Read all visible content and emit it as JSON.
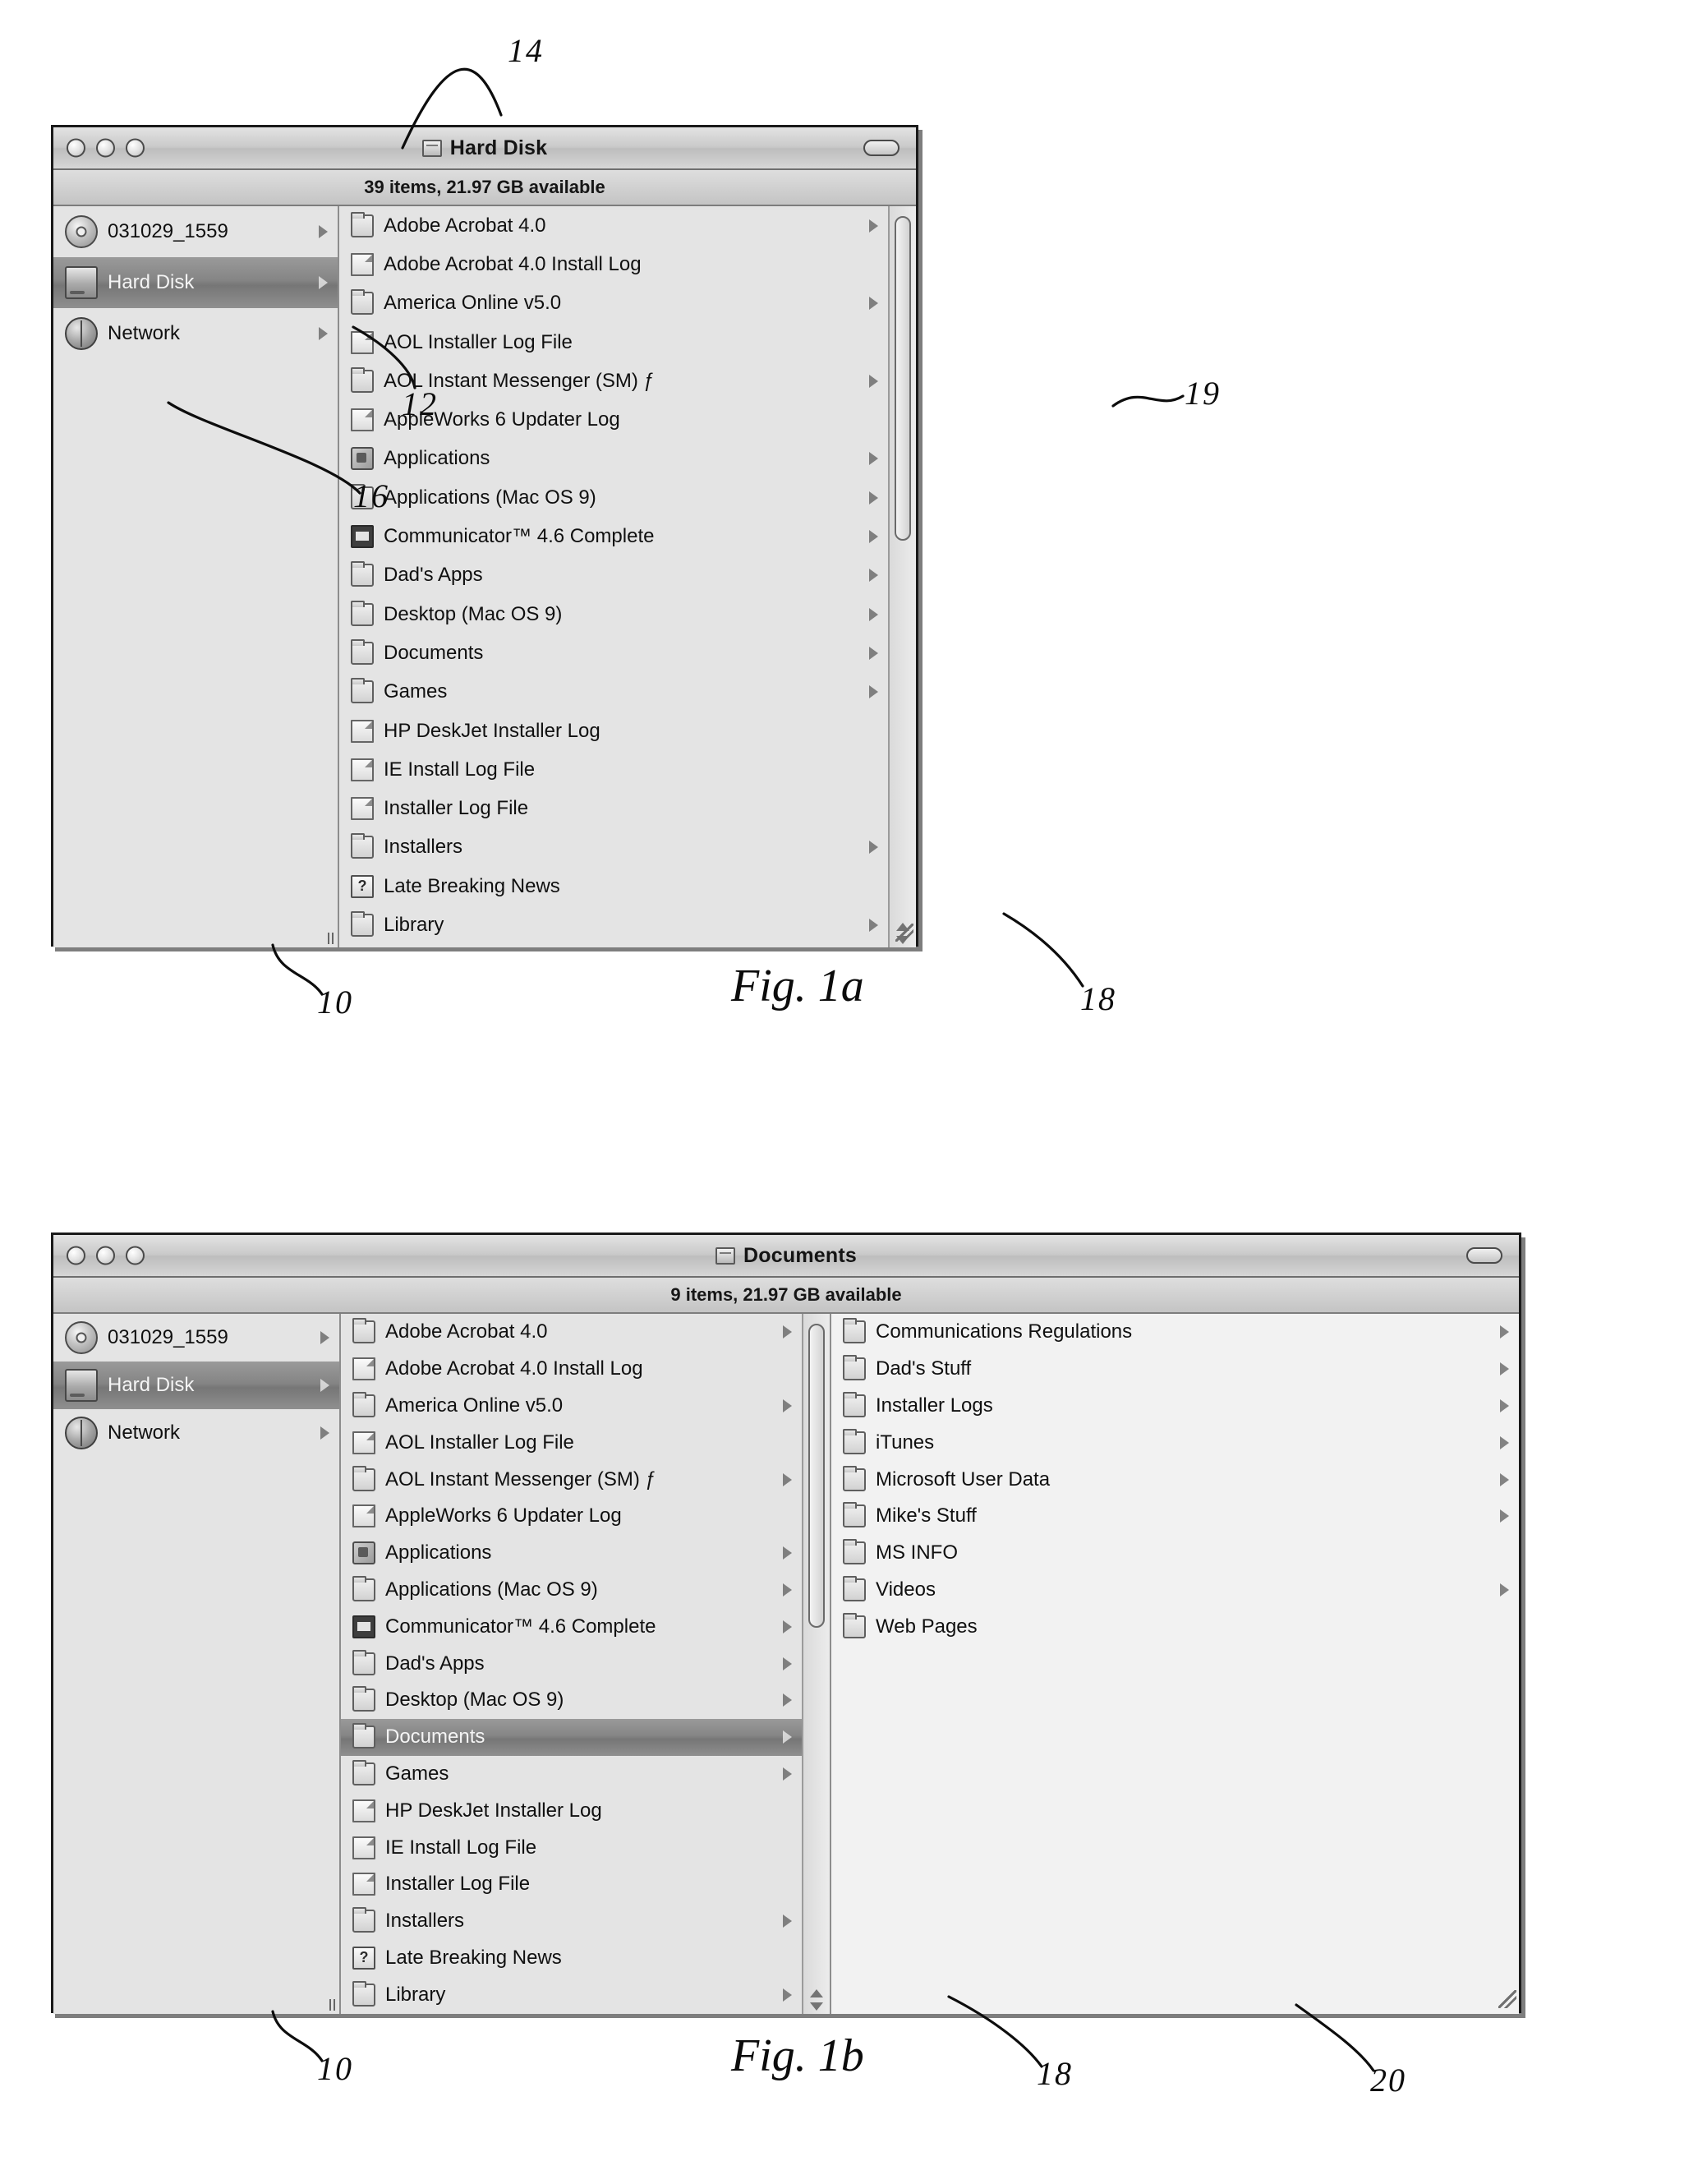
{
  "figures": [
    {
      "id": "fig-1a",
      "caption": "Fig. 1a",
      "window": {
        "title": "Hard Disk",
        "title_icon": "hard-disk-icon",
        "status": "39 items, 21.97 GB available",
        "sidebar": [
          {
            "label": "031029_1559",
            "icon": "disc-icon",
            "arrow": true,
            "selected": false
          },
          {
            "label": "Hard Disk",
            "icon": "hard-disk-icon",
            "arrow": true,
            "selected": true
          },
          {
            "label": "Network",
            "icon": "network-globe-icon",
            "arrow": true,
            "selected": false
          }
        ],
        "file_list": [
          {
            "label": "Adobe Acrobat 4.0",
            "icon": "folder-icon",
            "arrow": true
          },
          {
            "label": "Adobe Acrobat 4.0 Install Log",
            "icon": "document-icon",
            "arrow": false
          },
          {
            "label": "America Online v5.0",
            "icon": "folder-icon",
            "arrow": true
          },
          {
            "label": "AOL Installer Log File",
            "icon": "document-icon",
            "arrow": false
          },
          {
            "label": "AOL Instant Messenger (SM) ƒ",
            "icon": "folder-icon",
            "arrow": true
          },
          {
            "label": "AppleWorks 6 Updater Log",
            "icon": "document-icon",
            "arrow": false
          },
          {
            "label": "Applications",
            "icon": "applications-folder-icon",
            "arrow": true
          },
          {
            "label": "Applications (Mac OS 9)",
            "icon": "folder-icon",
            "arrow": true
          },
          {
            "label": "Communicator™ 4.6 Complete",
            "icon": "package-icon",
            "arrow": true
          },
          {
            "label": "Dad's Apps",
            "icon": "folder-icon",
            "arrow": true
          },
          {
            "label": "Desktop (Mac OS 9)",
            "icon": "folder-icon",
            "arrow": true
          },
          {
            "label": "Documents",
            "icon": "folder-icon",
            "arrow": true
          },
          {
            "label": "Games",
            "icon": "folder-icon",
            "arrow": true
          },
          {
            "label": "HP DeskJet Installer Log",
            "icon": "document-icon",
            "arrow": false
          },
          {
            "label": "IE Install Log File",
            "icon": "document-icon",
            "arrow": false
          },
          {
            "label": "Installer Log File",
            "icon": "document-icon",
            "arrow": false
          },
          {
            "label": "Installers",
            "icon": "folder-icon",
            "arrow": true
          },
          {
            "label": "Late Breaking News",
            "icon": "help-document-icon",
            "arrow": false
          },
          {
            "label": "Library",
            "icon": "library-folder-icon",
            "arrow": true
          }
        ]
      },
      "annotations": [
        {
          "id": "n14",
          "text": "14"
        },
        {
          "id": "n12",
          "text": "12"
        },
        {
          "id": "n16",
          "text": "16"
        },
        {
          "id": "n19",
          "text": "19"
        },
        {
          "id": "n10",
          "text": "10"
        },
        {
          "id": "n18",
          "text": "18"
        }
      ]
    },
    {
      "id": "fig-1b",
      "caption": "Fig. 1b",
      "window": {
        "title": "Documents",
        "title_icon": "folder-icon",
        "status": "9 items, 21.97 GB available",
        "sidebar": [
          {
            "label": "031029_1559",
            "icon": "disc-icon",
            "arrow": true,
            "selected": false
          },
          {
            "label": "Hard Disk",
            "icon": "hard-disk-icon",
            "arrow": true,
            "selected": true
          },
          {
            "label": "Network",
            "icon": "network-globe-icon",
            "arrow": true,
            "selected": false
          }
        ],
        "file_list": [
          {
            "label": "Adobe Acrobat 4.0",
            "icon": "folder-icon",
            "arrow": true
          },
          {
            "label": "Adobe Acrobat 4.0 Install Log",
            "icon": "document-icon",
            "arrow": false
          },
          {
            "label": "America Online v5.0",
            "icon": "folder-icon",
            "arrow": true
          },
          {
            "label": "AOL Installer Log File",
            "icon": "document-icon",
            "arrow": false
          },
          {
            "label": "AOL Instant Messenger (SM) ƒ",
            "icon": "folder-icon",
            "arrow": true
          },
          {
            "label": "AppleWorks 6 Updater Log",
            "icon": "document-icon",
            "arrow": false
          },
          {
            "label": "Applications",
            "icon": "applications-folder-icon",
            "arrow": true
          },
          {
            "label": "Applications (Mac OS 9)",
            "icon": "folder-icon",
            "arrow": true
          },
          {
            "label": "Communicator™ 4.6 Complete",
            "icon": "package-icon",
            "arrow": true
          },
          {
            "label": "Dad's Apps",
            "icon": "folder-icon",
            "arrow": true
          },
          {
            "label": "Desktop (Mac OS 9)",
            "icon": "folder-icon",
            "arrow": true
          },
          {
            "label": "Documents",
            "icon": "folder-icon",
            "arrow": true,
            "selected": true
          },
          {
            "label": "Games",
            "icon": "folder-icon",
            "arrow": true
          },
          {
            "label": "HP DeskJet Installer Log",
            "icon": "document-icon",
            "arrow": false
          },
          {
            "label": "IE Install Log File",
            "icon": "document-icon",
            "arrow": false
          },
          {
            "label": "Installer Log File",
            "icon": "document-icon",
            "arrow": false
          },
          {
            "label": "Installers",
            "icon": "folder-icon",
            "arrow": true
          },
          {
            "label": "Late Breaking News",
            "icon": "help-document-icon",
            "arrow": false
          },
          {
            "label": "Library",
            "icon": "library-folder-icon",
            "arrow": true
          }
        ],
        "detail_list": [
          {
            "label": "Communications Regulations",
            "icon": "folder-icon",
            "arrow": true
          },
          {
            "label": "Dad's Stuff",
            "icon": "folder-icon",
            "arrow": true
          },
          {
            "label": "Installer Logs",
            "icon": "folder-icon",
            "arrow": true
          },
          {
            "label": "iTunes",
            "icon": "folder-icon",
            "arrow": true
          },
          {
            "label": "Microsoft User Data",
            "icon": "folder-icon",
            "arrow": true
          },
          {
            "label": "Mike's Stuff",
            "icon": "folder-icon",
            "arrow": true
          },
          {
            "label": "MS INFO",
            "icon": "folder-icon",
            "arrow": false
          },
          {
            "label": "Videos",
            "icon": "folder-icon",
            "arrow": true
          },
          {
            "label": "Web Pages",
            "icon": "folder-icon",
            "arrow": false
          }
        ]
      },
      "annotations": [
        {
          "id": "b10",
          "text": "10"
        },
        {
          "id": "b18",
          "text": "18"
        },
        {
          "id": "b20",
          "text": "20"
        }
      ]
    }
  ]
}
